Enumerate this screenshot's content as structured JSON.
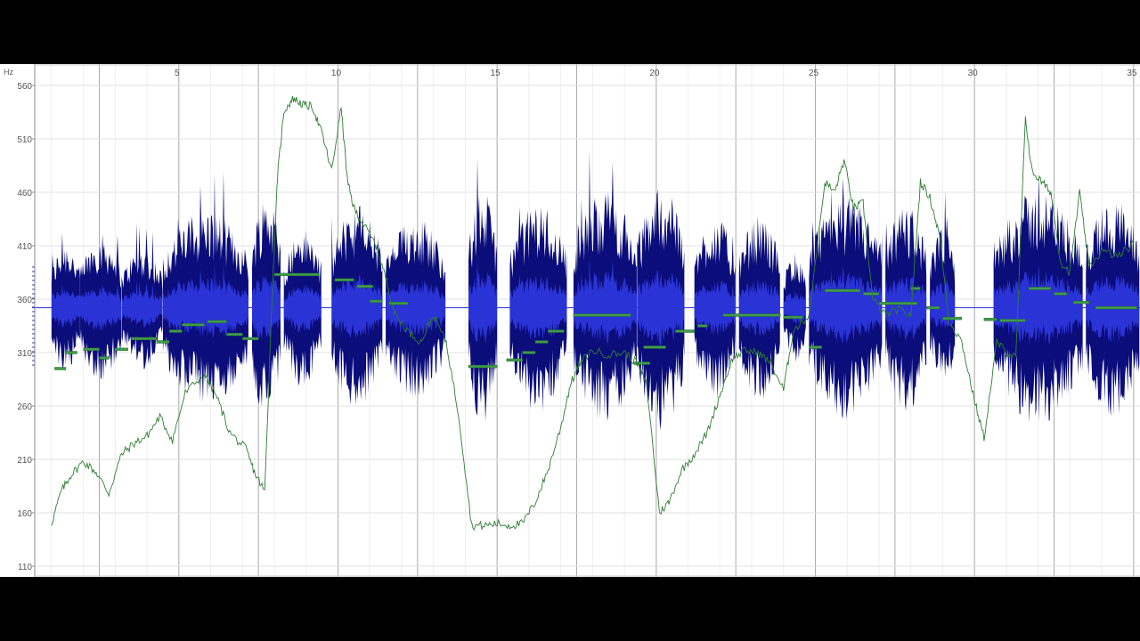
{
  "chart_data": {
    "type": "line",
    "title": "",
    "xlabel": "",
    "ylabel": "Hz",
    "x_ticks": [
      5,
      10,
      15,
      20,
      25,
      30,
      35
    ],
    "y_ticks": [
      110,
      160,
      210,
      260,
      310,
      360,
      410,
      460,
      510,
      560
    ],
    "xlim": [
      0.5,
      35.2
    ],
    "ylim": [
      100,
      580
    ],
    "grid": true,
    "colors": {
      "background": "#ffffff",
      "letterbox": "#000000",
      "waveform_outer": "#0b0d7a",
      "waveform_inner": "#2a33d6",
      "pitch_curve": "#2e7d32",
      "note_bar": "#3f9b4a",
      "grid_major": "#aaaaaa",
      "grid_minor": "#eeeeee"
    },
    "waveform": {
      "center_hz": 352,
      "segments": [
        {
          "start": 1.0,
          "end": 1.9,
          "amp": 0.55
        },
        {
          "start": 1.9,
          "end": 3.2,
          "amp": 0.6
        },
        {
          "start": 3.2,
          "end": 4.5,
          "amp": 0.5
        },
        {
          "start": 4.5,
          "end": 7.2,
          "amp": 0.8
        },
        {
          "start": 7.3,
          "end": 8.2,
          "amp": 0.95
        },
        {
          "start": 8.3,
          "end": 9.5,
          "amp": 0.65
        },
        {
          "start": 9.8,
          "end": 11.4,
          "amp": 0.85
        },
        {
          "start": 11.5,
          "end": 13.4,
          "amp": 0.75
        },
        {
          "start": 14.1,
          "end": 15.0,
          "amp": 0.95
        },
        {
          "start": 15.4,
          "end": 17.2,
          "amp": 0.85
        },
        {
          "start": 17.4,
          "end": 19.4,
          "amp": 0.95
        },
        {
          "start": 19.4,
          "end": 20.9,
          "amp": 1.0
        },
        {
          "start": 21.2,
          "end": 22.5,
          "amp": 0.75
        },
        {
          "start": 22.6,
          "end": 23.9,
          "amp": 0.75
        },
        {
          "start": 24.0,
          "end": 24.7,
          "amp": 0.45
        },
        {
          "start": 24.8,
          "end": 27.1,
          "amp": 0.9
        },
        {
          "start": 27.2,
          "end": 28.5,
          "amp": 0.85
        },
        {
          "start": 28.6,
          "end": 29.4,
          "amp": 0.65
        },
        {
          "start": 30.6,
          "end": 33.4,
          "amp": 0.95
        },
        {
          "start": 33.5,
          "end": 35.2,
          "amp": 0.9
        }
      ]
    },
    "pitch_curve": [
      [
        1.0,
        150
      ],
      [
        1.3,
        180
      ],
      [
        1.6,
        195
      ],
      [
        2.0,
        208
      ],
      [
        2.4,
        198
      ],
      [
        2.8,
        178
      ],
      [
        3.2,
        215
      ],
      [
        3.6,
        225
      ],
      [
        4.0,
        232
      ],
      [
        4.4,
        250
      ],
      [
        4.8,
        228
      ],
      [
        5.2,
        272
      ],
      [
        5.8,
        290
      ],
      [
        6.2,
        268
      ],
      [
        6.6,
        235
      ],
      [
        7.1,
        220
      ],
      [
        7.4,
        196
      ],
      [
        7.7,
        180
      ],
      [
        7.9,
        340
      ],
      [
        8.1,
        475
      ],
      [
        8.3,
        536
      ],
      [
        8.6,
        548
      ],
      [
        8.9,
        542
      ],
      [
        9.2,
        540
      ],
      [
        9.5,
        515
      ],
      [
        9.8,
        480
      ],
      [
        10.1,
        540
      ],
      [
        10.3,
        470
      ],
      [
        10.5,
        445
      ],
      [
        10.8,
        430
      ],
      [
        11.2,
        410
      ],
      [
        11.5,
        380
      ],
      [
        11.8,
        345
      ],
      [
        12.2,
        330
      ],
      [
        12.6,
        320
      ],
      [
        13.0,
        345
      ],
      [
        13.4,
        320
      ],
      [
        13.8,
        250
      ],
      [
        14.2,
        148
      ],
      [
        14.6,
        148
      ],
      [
        15.0,
        150
      ],
      [
        15.4,
        148
      ],
      [
        15.8,
        150
      ],
      [
        16.2,
        170
      ],
      [
        16.6,
        200
      ],
      [
        17.0,
        240
      ],
      [
        17.3,
        280
      ],
      [
        17.6,
        300
      ],
      [
        18.0,
        312
      ],
      [
        18.5,
        308
      ],
      [
        19.0,
        310
      ],
      [
        19.4,
        300
      ],
      [
        19.7,
        280
      ],
      [
        20.1,
        160
      ],
      [
        20.4,
        170
      ],
      [
        20.8,
        200
      ],
      [
        21.2,
        215
      ],
      [
        21.6,
        235
      ],
      [
        22.0,
        270
      ],
      [
        22.4,
        305
      ],
      [
        22.8,
        312
      ],
      [
        23.2,
        310
      ],
      [
        23.6,
        300
      ],
      [
        24.0,
        275
      ],
      [
        24.3,
        330
      ],
      [
        24.8,
        345
      ],
      [
        25.3,
        470
      ],
      [
        25.6,
        460
      ],
      [
        25.9,
        490
      ],
      [
        26.2,
        445
      ],
      [
        26.5,
        450
      ],
      [
        26.8,
        360
      ],
      [
        27.2,
        345
      ],
      [
        27.6,
        350
      ],
      [
        28.0,
        345
      ],
      [
        28.3,
        470
      ],
      [
        28.6,
        455
      ],
      [
        28.9,
        420
      ],
      [
        29.2,
        340
      ],
      [
        29.6,
        320
      ],
      [
        30.0,
        265
      ],
      [
        30.3,
        230
      ],
      [
        30.7,
        320
      ],
      [
        31.0,
        310
      ],
      [
        31.3,
        305
      ],
      [
        31.6,
        530
      ],
      [
        31.8,
        480
      ],
      [
        32.1,
        470
      ],
      [
        32.4,
        460
      ],
      [
        32.7,
        395
      ],
      [
        33.0,
        385
      ],
      [
        33.3,
        460
      ],
      [
        33.6,
        390
      ],
      [
        34.0,
        405
      ],
      [
        34.5,
        400
      ],
      [
        35.0,
        412
      ]
    ],
    "note_bars": [
      [
        1.1,
        1.45,
        295
      ],
      [
        1.45,
        1.8,
        310
      ],
      [
        2.0,
        2.5,
        313
      ],
      [
        2.5,
        2.8,
        305
      ],
      [
        3.0,
        3.4,
        313
      ],
      [
        3.5,
        4.3,
        323
      ],
      [
        4.3,
        4.7,
        320
      ],
      [
        4.7,
        5.1,
        330
      ],
      [
        5.1,
        5.8,
        336
      ],
      [
        5.9,
        6.5,
        339
      ],
      [
        6.5,
        7.0,
        327
      ],
      [
        7.0,
        7.5,
        323
      ],
      [
        8.0,
        9.4,
        383
      ],
      [
        9.9,
        10.5,
        378
      ],
      [
        10.6,
        11.1,
        372
      ],
      [
        11.0,
        11.4,
        358
      ],
      [
        11.6,
        12.2,
        356
      ],
      [
        14.1,
        15.0,
        297
      ],
      [
        15.3,
        15.8,
        303
      ],
      [
        15.8,
        16.2,
        310
      ],
      [
        16.2,
        16.6,
        320
      ],
      [
        16.6,
        17.1,
        330
      ],
      [
        17.4,
        19.2,
        345
      ],
      [
        19.3,
        19.8,
        300
      ],
      [
        19.6,
        20.3,
        315
      ],
      [
        20.6,
        21.2,
        330
      ],
      [
        21.3,
        21.6,
        335
      ],
      [
        22.1,
        23.9,
        345
      ],
      [
        24.0,
        24.6,
        343
      ],
      [
        24.8,
        25.2,
        315
      ],
      [
        25.3,
        26.4,
        368
      ],
      [
        26.5,
        27.0,
        365
      ],
      [
        27.0,
        28.2,
        356
      ],
      [
        28.0,
        28.3,
        370
      ],
      [
        28.5,
        28.9,
        352
      ],
      [
        29.0,
        29.6,
        342
      ],
      [
        30.3,
        30.7,
        341
      ],
      [
        30.8,
        31.6,
        340
      ],
      [
        31.7,
        32.4,
        370
      ],
      [
        32.5,
        32.9,
        365
      ],
      [
        33.1,
        33.6,
        357
      ],
      [
        33.8,
        35.1,
        352
      ]
    ]
  }
}
